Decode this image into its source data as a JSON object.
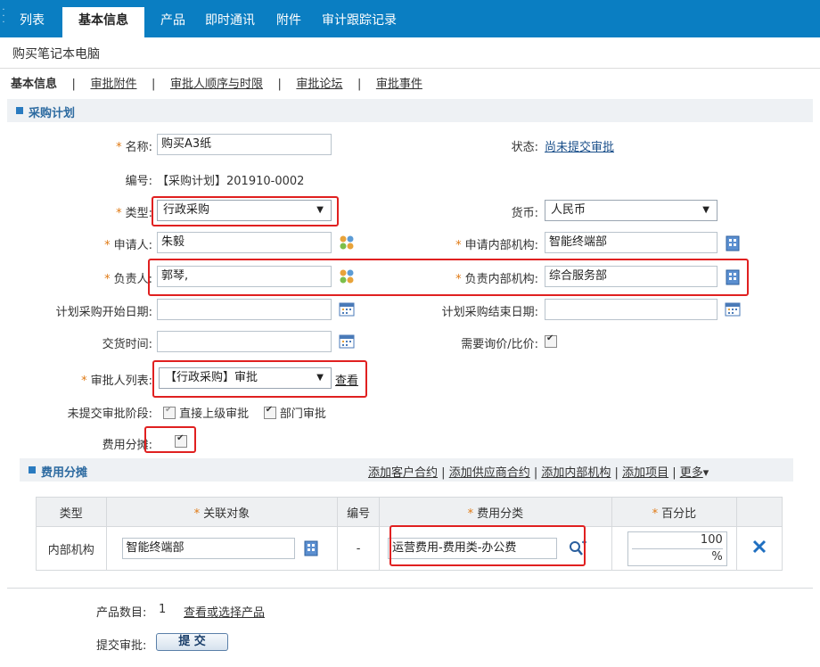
{
  "tabs": [
    {
      "label": "列表"
    },
    {
      "label": "基本信息"
    },
    {
      "label": "产品"
    },
    {
      "label": "即时通讯"
    },
    {
      "label": "附件"
    },
    {
      "label": "审计跟踪记录"
    }
  ],
  "page_title": "购买笔记本电脑",
  "subtabs": {
    "current": "基本信息",
    "sep": "|",
    "items": [
      "审批附件",
      "审批人顺序与时限",
      "审批论坛",
      "审批事件"
    ]
  },
  "plan": {
    "section_title": "采购计划",
    "required_mark": "*",
    "name_label": "名称:",
    "name_value": "购买A3纸",
    "status_label": "状态:",
    "status_value": "尚未提交审批",
    "code_label": "编号:",
    "code_value": "【采购计划】201910-0002",
    "type_label": "类型:",
    "type_value": "行政采购",
    "currency_label": "货币:",
    "currency_value": "人民币",
    "applicant_label": "申请人:",
    "applicant_value": "朱毅",
    "applicant_org_label": "申请内部机构:",
    "applicant_org_value": "智能终端部",
    "owner_label": "负责人:",
    "owner_value": "郭琴,",
    "owner_org_label": "负责内部机构:",
    "owner_org_value": "综合服务部",
    "start_date_label": "计划采购开始日期:",
    "end_date_label": "计划采购结束日期:",
    "delivery_label": "交货时间:",
    "inquiry_label": "需要询价/比价:",
    "approver_label": "审批人列表:",
    "approver_value": "【行政采购】审批",
    "approver_view": "查看",
    "stage_label": "未提交审批阶段:",
    "stage_opt1": "直接上级审批",
    "stage_opt2": "部门审批",
    "split_label": "费用分摊:"
  },
  "cost": {
    "section_title": "费用分摊",
    "actions": [
      "添加客户合约",
      "添加供应商合约",
      "添加内部机构",
      "添加项目",
      "更多"
    ],
    "sep": "|",
    "more_arrow": "▾",
    "headers": {
      "type": "类型",
      "object": "关联对象",
      "code": "编号",
      "category": "费用分类",
      "percent": "百分比"
    },
    "row": {
      "type": "内部机构",
      "object": "智能终端部",
      "code": "-",
      "category": "运营费用-费用类-办公费",
      "percent": "100",
      "percent_unit": "%"
    }
  },
  "footer": {
    "product_count_label": "产品数目:",
    "product_count_value": "1",
    "product_link": "查看或选择产品",
    "submit_label": "提交审批:",
    "submit_button": "提 交"
  },
  "colors": {
    "topbar": "#0a7ec2",
    "section_bg": "#eef1f4",
    "required": "#e07a14",
    "highlight": "#e02020",
    "delete": "#1f6fc0"
  }
}
